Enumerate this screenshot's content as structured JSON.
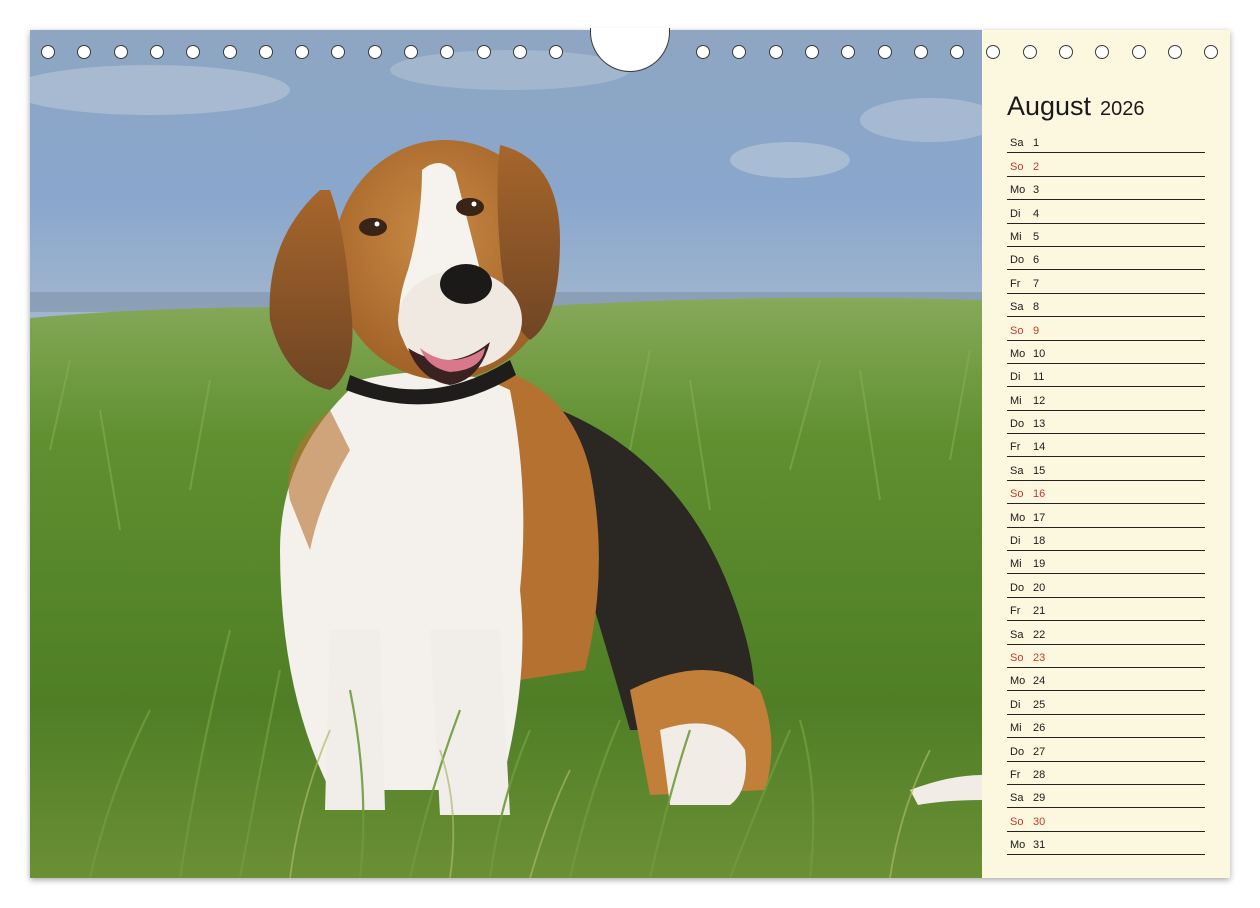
{
  "calendar": {
    "month": "August",
    "year": "2026",
    "days": [
      {
        "dow": "Sa",
        "date": "1",
        "sunday": false
      },
      {
        "dow": "So",
        "date": "2",
        "sunday": true
      },
      {
        "dow": "Mo",
        "date": "3",
        "sunday": false
      },
      {
        "dow": "Di",
        "date": "4",
        "sunday": false
      },
      {
        "dow": "Mi",
        "date": "5",
        "sunday": false
      },
      {
        "dow": "Do",
        "date": "6",
        "sunday": false
      },
      {
        "dow": "Fr",
        "date": "7",
        "sunday": false
      },
      {
        "dow": "Sa",
        "date": "8",
        "sunday": false
      },
      {
        "dow": "So",
        "date": "9",
        "sunday": true
      },
      {
        "dow": "Mo",
        "date": "10",
        "sunday": false
      },
      {
        "dow": "Di",
        "date": "11",
        "sunday": false
      },
      {
        "dow": "Mi",
        "date": "12",
        "sunday": false
      },
      {
        "dow": "Do",
        "date": "13",
        "sunday": false
      },
      {
        "dow": "Fr",
        "date": "14",
        "sunday": false
      },
      {
        "dow": "Sa",
        "date": "15",
        "sunday": false
      },
      {
        "dow": "So",
        "date": "16",
        "sunday": true
      },
      {
        "dow": "Mo",
        "date": "17",
        "sunday": false
      },
      {
        "dow": "Di",
        "date": "18",
        "sunday": false
      },
      {
        "dow": "Mi",
        "date": "19",
        "sunday": false
      },
      {
        "dow": "Do",
        "date": "20",
        "sunday": false
      },
      {
        "dow": "Fr",
        "date": "21",
        "sunday": false
      },
      {
        "dow": "Sa",
        "date": "22",
        "sunday": false
      },
      {
        "dow": "So",
        "date": "23",
        "sunday": true
      },
      {
        "dow": "Mo",
        "date": "24",
        "sunday": false
      },
      {
        "dow": "Di",
        "date": "25",
        "sunday": false
      },
      {
        "dow": "Mi",
        "date": "26",
        "sunday": false
      },
      {
        "dow": "Do",
        "date": "27",
        "sunday": false
      },
      {
        "dow": "Fr",
        "date": "28",
        "sunday": false
      },
      {
        "dow": "Sa",
        "date": "29",
        "sunday": false
      },
      {
        "dow": "So",
        "date": "30",
        "sunday": true
      },
      {
        "dow": "Mo",
        "date": "31",
        "sunday": false
      }
    ]
  },
  "photo": {
    "subject": "beagle-sitting-in-grass",
    "colors": {
      "sky": "#8aa5c6",
      "grass": "#5c8f2c",
      "fur_tan": "#b8702e",
      "fur_white": "#f4f1ec",
      "fur_black": "#2b2723"
    }
  },
  "theme": {
    "panel_bg": "#fcf8e0",
    "sunday_color": "#c23a2a",
    "text_color": "#1a1a1a"
  }
}
